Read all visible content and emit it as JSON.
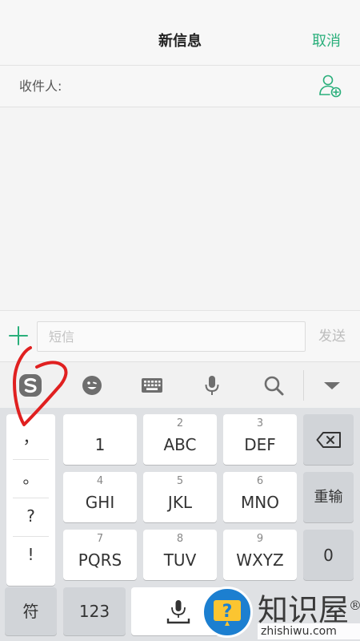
{
  "header": {
    "title": "新信息",
    "cancel_label": "取消"
  },
  "recipient": {
    "label": "收件人:",
    "icon": "add-contact-icon"
  },
  "compose": {
    "placeholder": "短信",
    "send_label": "发送",
    "plus_icon": "plus-icon"
  },
  "ime_toolbar": {
    "icons": [
      "sogou-logo-icon",
      "emoji-icon",
      "keyboard-icon",
      "microphone-icon",
      "search-icon",
      "collapse-icon"
    ]
  },
  "keyboard": {
    "punctuation": [
      "，",
      "。",
      "?",
      "!"
    ],
    "keys": [
      {
        "num": "",
        "main": "1"
      },
      {
        "num": "2",
        "main": "ABC"
      },
      {
        "num": "3",
        "main": "DEF"
      },
      {
        "num": "4",
        "main": "GHI"
      },
      {
        "num": "5",
        "main": "JKL"
      },
      {
        "num": "6",
        "main": "MNO"
      },
      {
        "num": "7",
        "main": "PQRS"
      },
      {
        "num": "8",
        "main": "TUV"
      },
      {
        "num": "9",
        "main": "WXYZ"
      }
    ],
    "reenter_label": "重输",
    "zero_label": "0",
    "symbol_label": "符",
    "numbers_label": "123"
  },
  "watermark": {
    "text": "知识屋",
    "registered": "®",
    "site": "zhishiwu.com"
  },
  "colors": {
    "accent": "#2aaf7b",
    "annotation": "#e02020"
  }
}
